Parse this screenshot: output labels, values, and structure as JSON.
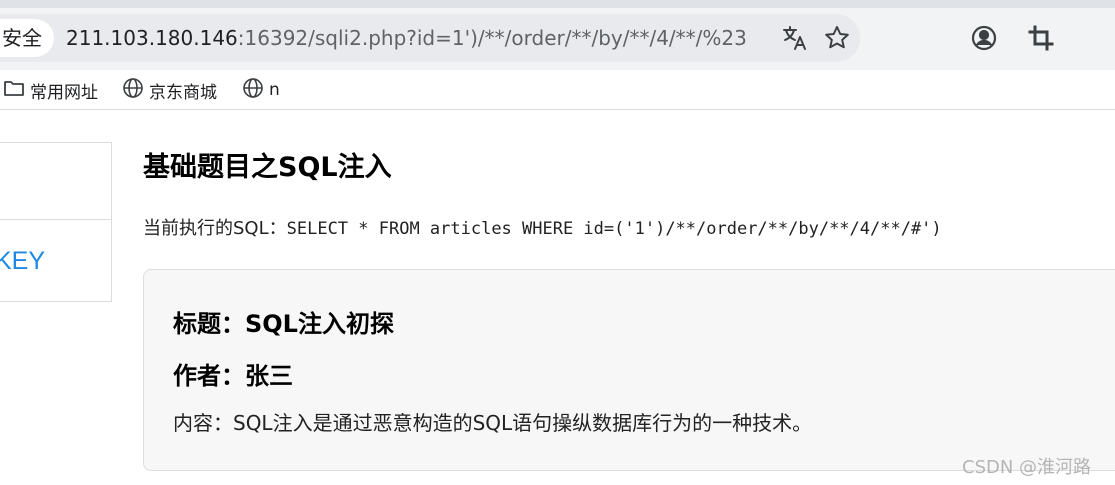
{
  "browser": {
    "security_chip": "安全",
    "url_host": "211.103.180.146",
    "url_rest": ":16392/sqli2.php?id=1')/**/order/**/by/**/4/**/%23",
    "icons": [
      "translate-icon",
      "star-icon",
      "account-icon",
      "crop-icon"
    ]
  },
  "bookmarks": [
    {
      "label": "常用网址",
      "icon": "folder-icon"
    },
    {
      "label": "京东商城",
      "icon": "globe-icon"
    },
    {
      "label": "n",
      "icon": "globe-icon"
    }
  ],
  "sidebar": {
    "partial_label": "KEY"
  },
  "page": {
    "title": "基础题目之SQL注入",
    "sql_prefix": "当前执行的SQL：",
    "sql_query": "SELECT * FROM articles WHERE id=('1')/**/order/**/by/**/4/**/#')",
    "article": {
      "title": "标题：SQL注入初探",
      "author": "作者：张三",
      "content": "内容：SQL注入是通过恶意构造的SQL语句操纵数据库行为的一种技术。"
    }
  },
  "watermark": "CSDN @淮河路",
  "colors": {
    "link_blue": "#1e88e5",
    "chrome_bg": "#f1f3f4",
    "card_bg": "#f7f7f7"
  }
}
